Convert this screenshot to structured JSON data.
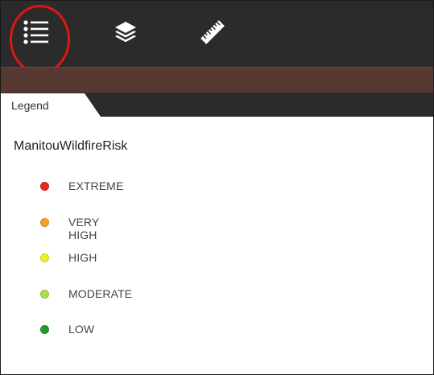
{
  "toolbar": {
    "buttons": [
      {
        "id": "legend",
        "icon": "list-icon",
        "highlighted": true
      },
      {
        "id": "layers",
        "icon": "layers-icon",
        "highlighted": false
      },
      {
        "id": "measure",
        "icon": "ruler-icon",
        "highlighted": false
      }
    ],
    "highlight_color": "#e01515"
  },
  "tabs": {
    "active_label": "Legend"
  },
  "legend": {
    "layer_title": "ManitouWildfireRisk",
    "items": [
      {
        "label": "EXTREME",
        "color": "#e8291c"
      },
      {
        "label": "VERY HIGH",
        "color": "#f0a030"
      },
      {
        "label": "HIGH",
        "color": "#f2ee28"
      },
      {
        "label": "MODERATE",
        "color": "#a6e24a"
      },
      {
        "label": "LOW",
        "color": "#2a9a2a"
      }
    ]
  },
  "colors": {
    "toolbar_bg": "#2b2b2b",
    "band_bg": "#553830"
  }
}
